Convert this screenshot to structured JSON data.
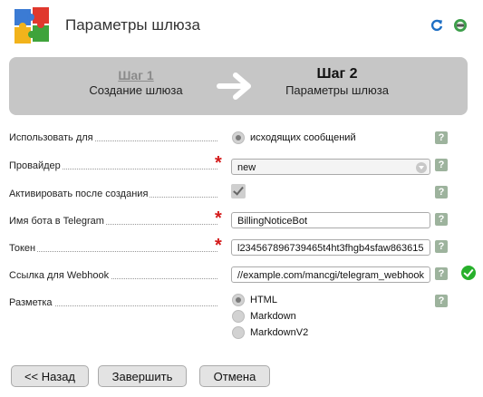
{
  "header": {
    "title": "Параметры шлюза"
  },
  "wizard": {
    "step1": {
      "number": "Шаг 1",
      "name": "Создание шлюза"
    },
    "step2": {
      "number": "Шаг 2",
      "name": "Параметры шлюза"
    }
  },
  "form": {
    "use_for": {
      "label": "Использовать для",
      "option": "исходящих сообщений",
      "help": "?"
    },
    "provider": {
      "label": "Провайдер",
      "value": "new",
      "required": "*",
      "help": "?"
    },
    "activate": {
      "label": "Активировать после создания",
      "checked": true,
      "help": "?"
    },
    "bot_name": {
      "label": "Имя бота в Telegram",
      "value": "BillingNoticeBot",
      "required": "*",
      "help": "?"
    },
    "token": {
      "label": "Токен",
      "value": "l234567896739465t4ht3fhgb4sfaw863615",
      "required": "*",
      "help": "?"
    },
    "webhook": {
      "label": "Ссылка для Webhook",
      "value": "//example.com/mancgi/telegram_webhook",
      "help": "?"
    },
    "markup": {
      "label": "Разметка",
      "help": "?",
      "options": [
        "HTML",
        "Markdown",
        "MarkdownV2"
      ],
      "selected": "HTML"
    }
  },
  "buttons": {
    "back": "<< Назад",
    "finish": "Завершить",
    "cancel": "Отмена"
  },
  "colors": {
    "banner": "#c6c6c6",
    "required": "#d41a1a",
    "help": "#9db39d",
    "ok": "#27b02b"
  }
}
